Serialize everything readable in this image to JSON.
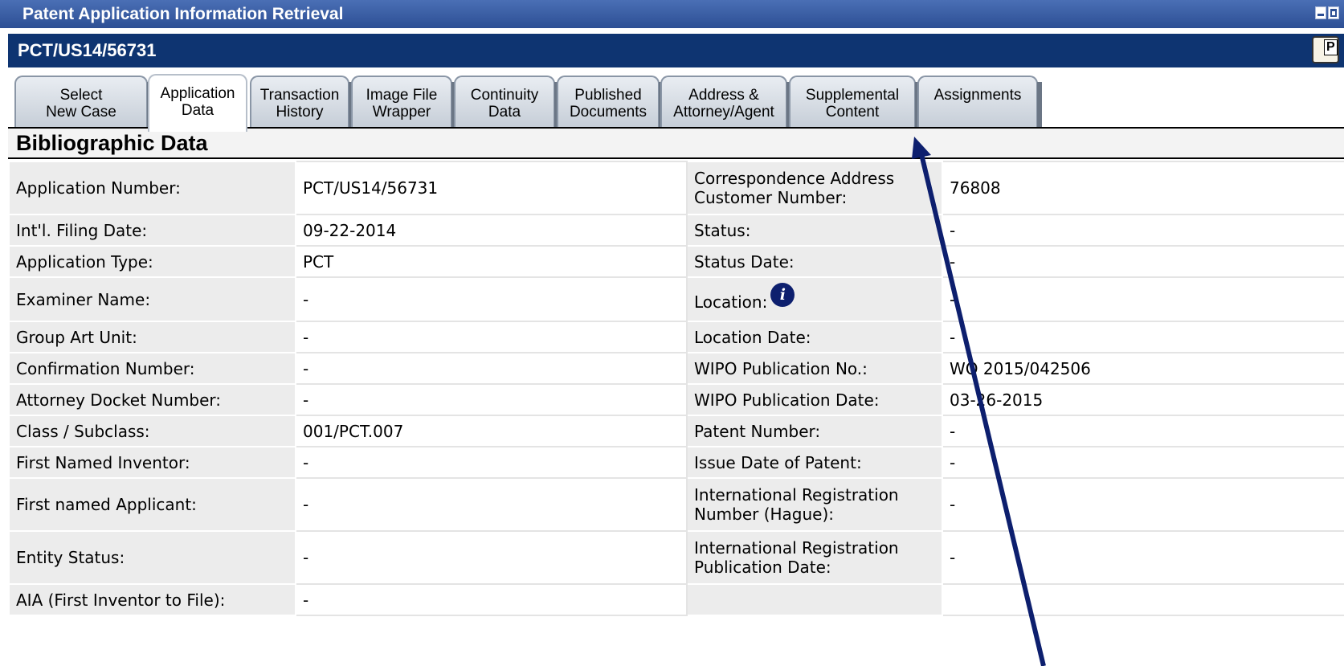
{
  "window": {
    "title": "Patent Application Information Retrieval"
  },
  "case": {
    "number": "PCT/US14/56731"
  },
  "tabs": [
    {
      "line1": "Select",
      "line2": "New Case"
    },
    {
      "line1": "Application",
      "line2": "Data"
    },
    {
      "line1": "Transaction",
      "line2": "History"
    },
    {
      "line1": "Image File",
      "line2": "Wrapper"
    },
    {
      "line1": "Continuity",
      "line2": "Data"
    },
    {
      "line1": "Published",
      "line2": "Documents"
    },
    {
      "line1": "Address &",
      "line2": "Attorney/Agent"
    },
    {
      "line1": "Supplemental",
      "line2": "Content"
    },
    {
      "line1": "Assignments",
      "line2": ""
    }
  ],
  "active_tab": "Application Data",
  "section": {
    "title": "Bibliographic Data"
  },
  "rows": [
    {
      "label": "Application Number:",
      "value": "PCT/US14/56731",
      "label2": "Correspondence Address Customer Number:",
      "value2": "76808"
    },
    {
      "label": "Int'l. Filing Date:",
      "value": "09-22-2014",
      "label2": "Status:",
      "value2": "-"
    },
    {
      "label": "Application Type:",
      "value": "PCT",
      "label2": "Status Date:",
      "value2": "-"
    },
    {
      "label": "Examiner Name:",
      "value": "-",
      "label2": "Location:",
      "value2": "-"
    },
    {
      "label": "Group Art Unit:",
      "value": "-",
      "label2": "Location Date:",
      "value2": "-"
    },
    {
      "label": "Confirmation Number:",
      "value": "-",
      "label2": "WIPO Publication No.:",
      "value2": "WO 2015/042506"
    },
    {
      "label": "Attorney Docket Number:",
      "value": "-",
      "label2": "WIPO Publication Date:",
      "value2": "03-26-2015"
    },
    {
      "label": "Class / Subclass:",
      "value": "001/PCT.007",
      "label2": "Patent Number:",
      "value2": "-"
    },
    {
      "label": "First Named Inventor:",
      "value": "-",
      "label2": "Issue Date of Patent:",
      "value2": "-"
    },
    {
      "label": "First named Applicant:",
      "value": "-",
      "label2": "International Registration Number (Hague):",
      "value2": "-"
    },
    {
      "label": "Entity Status:",
      "value": "-",
      "label2": "International Registration Publication Date:",
      "value2": "-"
    },
    {
      "label": "AIA (First Inventor to File):",
      "value": "-",
      "label2": "",
      "value2": ""
    }
  ],
  "icons": {
    "info": "i",
    "pdf": "P"
  },
  "colors": {
    "titlebar": "#2d4f94",
    "casebar": "#0e3471",
    "arrow": "#0d1f6e"
  }
}
